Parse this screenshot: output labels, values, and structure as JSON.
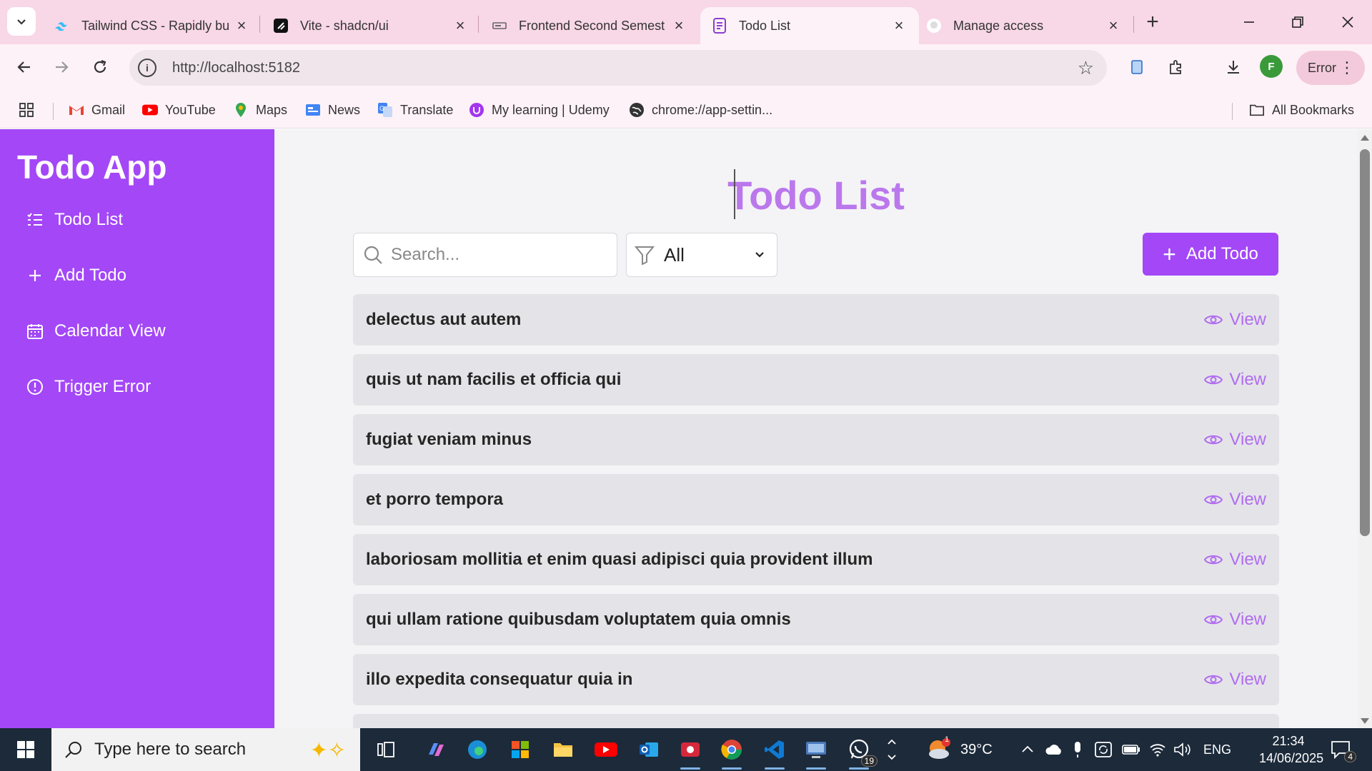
{
  "browser": {
    "tabs": [
      {
        "title": "Tailwind CSS - Rapidly bu",
        "icon": "tailwind-icon",
        "active": false
      },
      {
        "title": "Vite - shadcn/ui",
        "icon": "shadcn-icon",
        "active": false
      },
      {
        "title": "Frontend Second Semest",
        "icon": "slides-icon",
        "active": false
      },
      {
        "title": "Todo List",
        "icon": "page-icon",
        "active": true
      },
      {
        "title": "Manage access",
        "icon": "github-icon",
        "active": false
      }
    ],
    "url": "http://localhost:5182",
    "profile_initial": "F",
    "error_label": "Error",
    "bookmarks": [
      {
        "label": "Gmail",
        "icon": "gmail-icon"
      },
      {
        "label": "YouTube",
        "icon": "youtube-icon"
      },
      {
        "label": "Maps",
        "icon": "maps-icon"
      },
      {
        "label": "News",
        "icon": "news-icon"
      },
      {
        "label": "Translate",
        "icon": "translate-icon"
      },
      {
        "label": "My learning | Udemy",
        "icon": "udemy-icon"
      },
      {
        "label": "chrome://app-settin...",
        "icon": "globe-icon"
      }
    ],
    "all_bookmarks_label": "All Bookmarks"
  },
  "app": {
    "brand": "Todo App",
    "sidebar": [
      {
        "label": "Todo List",
        "icon": "list-icon"
      },
      {
        "label": "Add Todo",
        "icon": "plus-icon"
      },
      {
        "label": "Calendar View",
        "icon": "calendar-icon"
      },
      {
        "label": "Trigger Error",
        "icon": "alert-circle-icon"
      }
    ],
    "page_title": "Todo List",
    "search": {
      "placeholder": "Search...",
      "value": ""
    },
    "filter": {
      "selected": "All"
    },
    "add_button_label": "Add Todo",
    "view_label": "View",
    "todos": [
      "delectus aut autem",
      "quis ut nam facilis et officia qui",
      "fugiat veniam minus",
      "et porro tempora",
      "laboriosam mollitia et enim quasi adipisci quia provident illum",
      "qui ullam ratione quibusdam voluptatem quia omnis",
      "illo expedita consequatur quia in"
    ],
    "colors": {
      "accent": "#a347f7",
      "title": "#bb78ec",
      "row_bg": "#e4e4e8",
      "view_link": "#b16cf0"
    }
  },
  "taskbar": {
    "search_placeholder": "Type here to search",
    "weather": "39°C",
    "language": "ENG",
    "time": "21:34",
    "date": "14/06/2025",
    "whatsapp_badge": "19",
    "notification_count": "4",
    "weather_badge": "1"
  }
}
